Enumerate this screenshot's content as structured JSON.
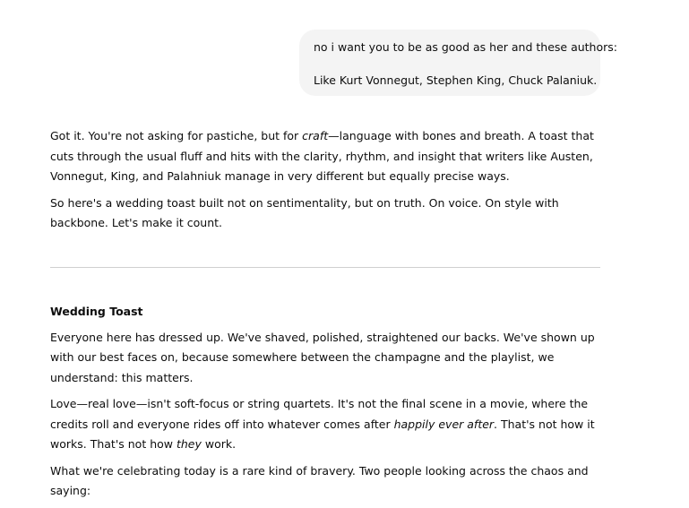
{
  "user_message": {
    "line1": "no i want you to be as good as her and these authors:",
    "line2": "Like Kurt Vonnegut, Stephen King, Chuck Palaniuk."
  },
  "assistant": {
    "intro": {
      "a": "Got it. You're not asking for pastiche, but for ",
      "em": "craft",
      "b": "—language with bones and breath. A toast that cuts through the usual fluff and hits with the clarity, rhythm, and insight that writers like Austen, Vonnegut, King, and Palahniuk manage in very different but equally precise ways."
    },
    "intro2": "So here's a wedding toast built not on sentimentality, but on truth. On voice. On style with backbone. Let's make it count.",
    "toast_title": "Wedding Toast",
    "toast_p1": "Everyone here has dressed up. We've shaved, polished, straightened our backs. We've shown up with our best faces on, because somewhere between the champagne and the playlist, we understand: this matters.",
    "toast_p2": {
      "a": "Love—real love—isn't soft-focus or string quartets. It's not the final scene in a movie, where the credits roll and everyone rides off into whatever comes after ",
      "em1": "happily ever after",
      "b": ". That's not how it works. That's not how ",
      "em2": "they",
      "c": " work."
    },
    "toast_p3_partial": "What we're celebrating today is a rare kind of bravery. Two people looking across the chaos and saying:"
  }
}
